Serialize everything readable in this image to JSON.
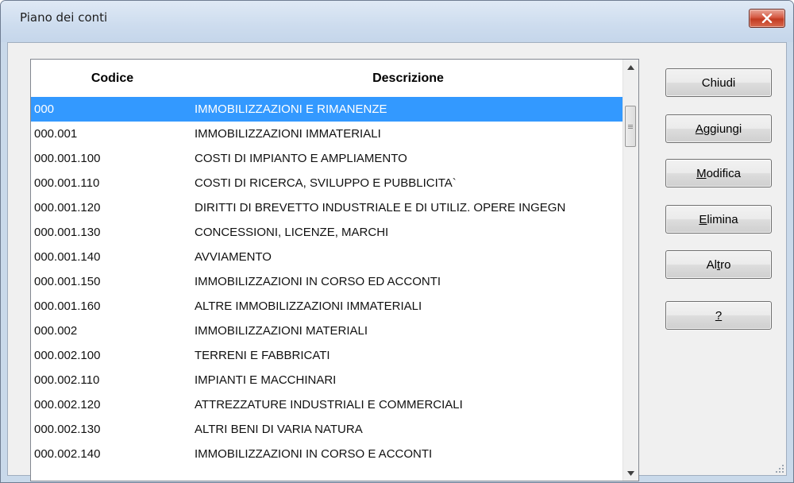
{
  "window": {
    "title": "Piano dei conti",
    "close_symbol": "✕"
  },
  "list": {
    "columns": [
      "Codice",
      "Descrizione"
    ],
    "selected_index": 0,
    "rows": [
      {
        "codice": "000",
        "descrizione": "IMMOBILIZZAZIONI E RIMANENZE"
      },
      {
        "codice": "000.001",
        "descrizione": "IMMOBILIZZAZIONI IMMATERIALI"
      },
      {
        "codice": "000.001.100",
        "descrizione": "COSTI DI IMPIANTO E AMPLIAMENTO"
      },
      {
        "codice": "000.001.110",
        "descrizione": "COSTI DI RICERCA, SVILUPPO E PUBBLICITA`"
      },
      {
        "codice": "000.001.120",
        "descrizione": "DIRITTI DI BREVETTO INDUSTRIALE E DI UTILIZ. OPERE INGEGN"
      },
      {
        "codice": "000.001.130",
        "descrizione": "CONCESSIONI, LICENZE, MARCHI"
      },
      {
        "codice": "000.001.140",
        "descrizione": "AVVIAMENTO"
      },
      {
        "codice": "000.001.150",
        "descrizione": "IMMOBILIZZAZIONI IN CORSO ED ACCONTI"
      },
      {
        "codice": "000.001.160",
        "descrizione": "ALTRE IMMOBILIZZAZIONI IMMATERIALI"
      },
      {
        "codice": "000.002",
        "descrizione": "IMMOBILIZZAZIONI MATERIALI"
      },
      {
        "codice": "000.002.100",
        "descrizione": "TERRENI E FABBRICATI"
      },
      {
        "codice": "000.002.110",
        "descrizione": "IMPIANTI E MACCHINARI"
      },
      {
        "codice": "000.002.120",
        "descrizione": "ATTREZZATURE INDUSTRIALI E COMMERCIALI"
      },
      {
        "codice": "000.002.130",
        "descrizione": "ALTRI BENI DI VARIA NATURA"
      },
      {
        "codice": "000.002.140",
        "descrizione": "IMMOBILIZZAZIONI IN CORSO E ACCONTI"
      }
    ]
  },
  "buttons": {
    "chiudi": {
      "pre": "Chiudi",
      "mnemonic": "",
      "post": ""
    },
    "aggiungi": {
      "pre": "",
      "mnemonic": "A",
      "post": "ggiungi"
    },
    "modifica": {
      "pre": "",
      "mnemonic": "M",
      "post": "odifica"
    },
    "elimina": {
      "pre": "",
      "mnemonic": "E",
      "post": "limina"
    },
    "altro": {
      "pre": "Al",
      "mnemonic": "t",
      "post": "ro"
    },
    "help": {
      "pre": "",
      "mnemonic": "?",
      "post": ""
    }
  },
  "colors": {
    "selection": "#3399ff",
    "close_button": "#c7412a"
  }
}
